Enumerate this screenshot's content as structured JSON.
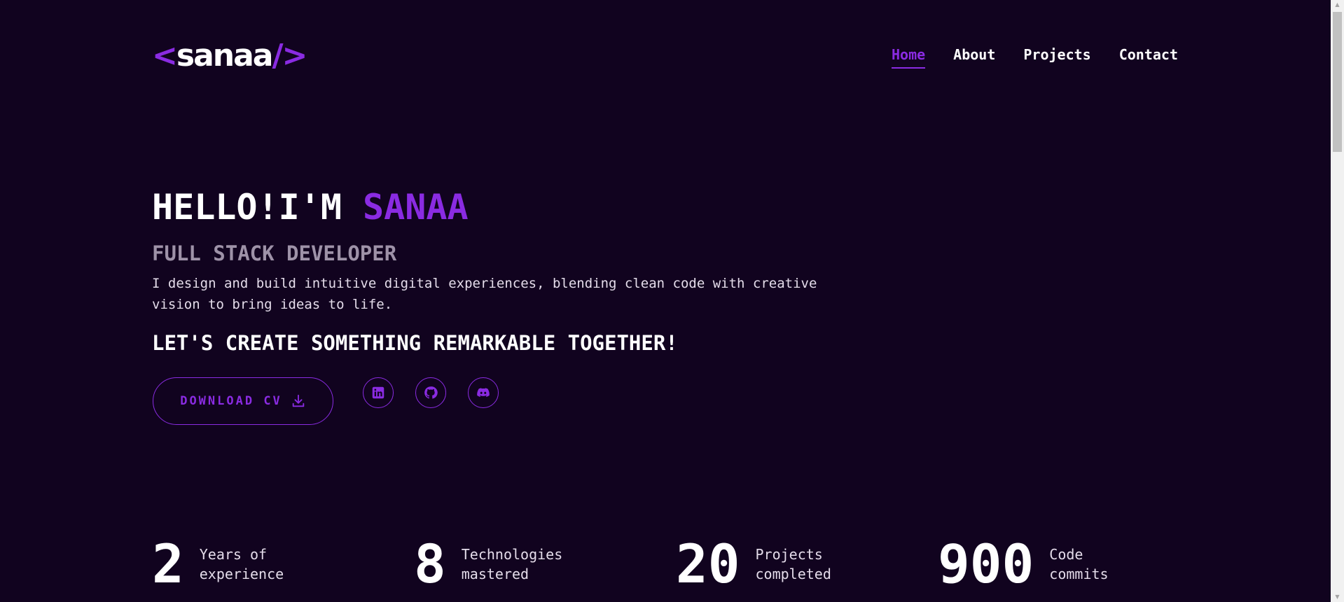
{
  "header": {
    "logo": {
      "open_bracket": "<",
      "name": "sanaa",
      "close_bracket": "/>"
    },
    "nav": [
      {
        "label": "Home",
        "active": true
      },
      {
        "label": "About",
        "active": false
      },
      {
        "label": "Projects",
        "active": false
      },
      {
        "label": "Contact",
        "active": false
      }
    ]
  },
  "hero": {
    "greeting": "HELLO!I'M ",
    "name": "SANAA",
    "role": "FULL STACK DEVELOPER",
    "description": "I design and build intuitive digital experiences, blending clean code with creative vision to bring ideas to life.",
    "cta": "LET'S CREATE SOMETHING REMARKABLE TOGETHER!",
    "download_label": "DOWNLOAD CV",
    "download_icon": "download-icon",
    "socials": [
      {
        "icon": "linkedin-icon"
      },
      {
        "icon": "github-icon"
      },
      {
        "icon": "discord-icon"
      }
    ]
  },
  "stats": [
    {
      "number": "2",
      "line1": "Years of",
      "line2": "experience"
    },
    {
      "number": "8",
      "line1": "Technologies",
      "line2": "mastered"
    },
    {
      "number": "20",
      "line1": "Projects",
      "line2": "completed"
    },
    {
      "number": "900",
      "line1": "Code",
      "line2": "commits"
    }
  ],
  "colors": {
    "background": "#11031f",
    "accent": "#8a2be2",
    "text": "#ffffff",
    "muted": "#9e92a8"
  }
}
